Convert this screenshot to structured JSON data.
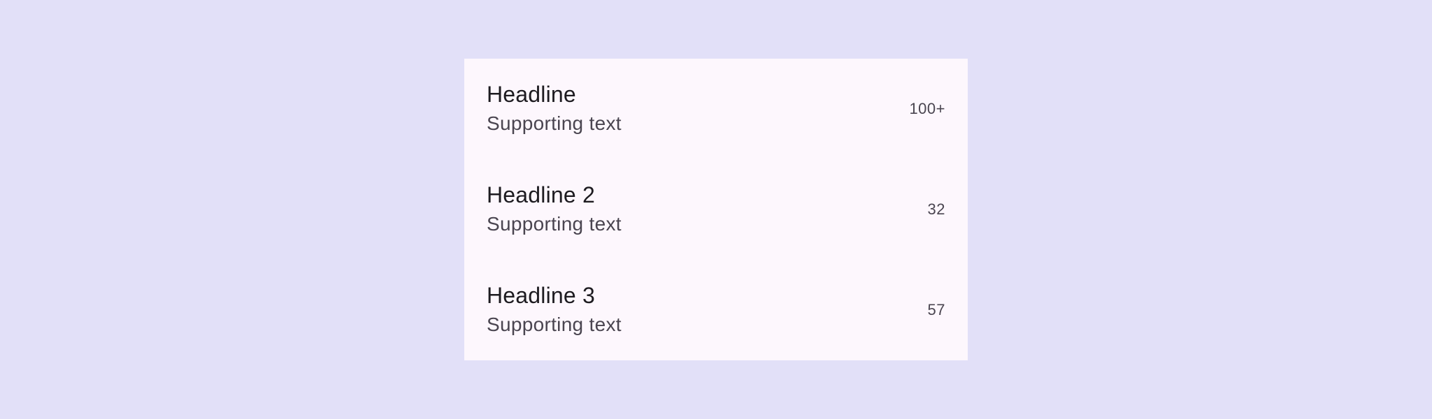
{
  "colors": {
    "background": "#e2e0f8",
    "surface": "#fdf7fd",
    "headline": "#1d1b20",
    "supporting": "#4a4550"
  },
  "list": {
    "items": [
      {
        "headline": "Headline",
        "supporting": "Supporting text",
        "trailing": "100+"
      },
      {
        "headline": "Headline 2",
        "supporting": "Supporting text",
        "trailing": "32"
      },
      {
        "headline": "Headline 3",
        "supporting": "Supporting text",
        "trailing": "57"
      }
    ]
  }
}
